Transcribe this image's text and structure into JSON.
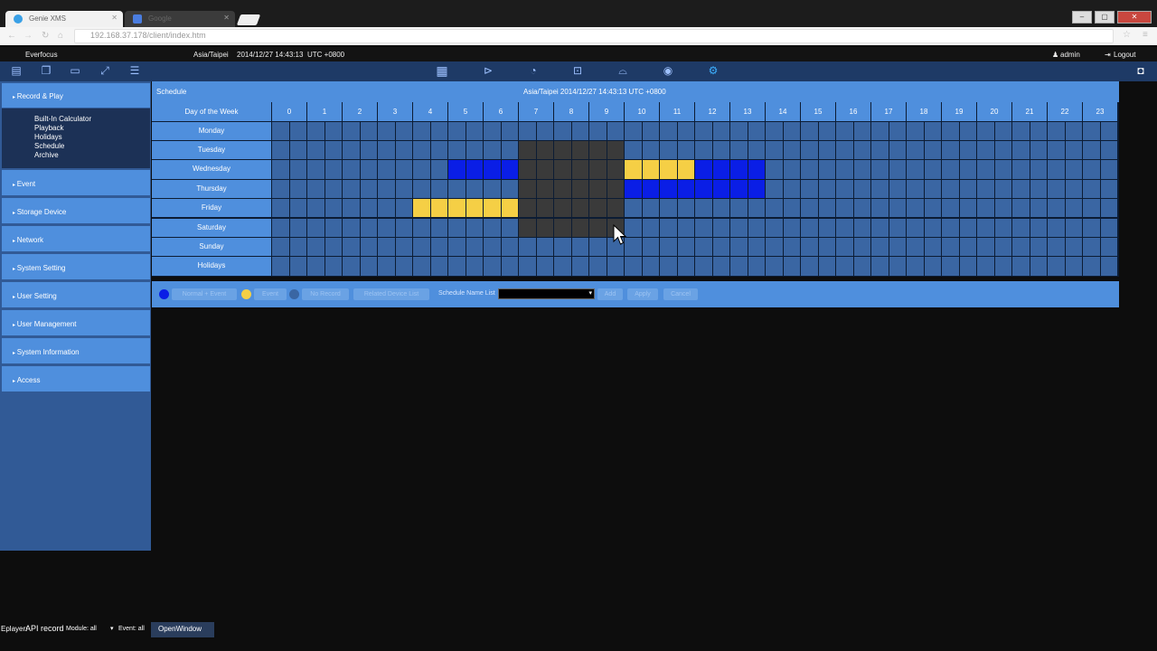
{
  "browser": {
    "tabs": [
      {
        "label": "Genie XMS"
      },
      {
        "label": "Google"
      }
    ],
    "url": "192.168.37.178/client/index.htm"
  },
  "topbar": {
    "brand": "Everfocus",
    "timezone": "Asia/Taipei",
    "datetime": "2014/12/27 14:43:13",
    "utc": "UTC +0800",
    "user": "admin",
    "logout": "Logout"
  },
  "sidebar": {
    "sections": [
      {
        "label": "Record & Play"
      },
      {
        "label": "Event"
      },
      {
        "label": "Storage Device"
      },
      {
        "label": "Network"
      },
      {
        "label": "System Setting"
      },
      {
        "label": "User Setting"
      },
      {
        "label": "User Management"
      },
      {
        "label": "System Information"
      },
      {
        "label": "Access"
      }
    ],
    "subitems": [
      "Built-In Calculator",
      "Playback",
      "Holidays",
      "Schedule",
      "Archive"
    ]
  },
  "schedule": {
    "title": "Schedule",
    "header_time": "Asia/Taipei 2014/12/27 14:43:13 UTC +0800",
    "day_header": "Day of the Week",
    "hours": [
      "0",
      "1",
      "2",
      "3",
      "4",
      "5",
      "6",
      "7",
      "8",
      "9",
      "10",
      "11",
      "12",
      "13",
      "14",
      "15",
      "16",
      "17",
      "18",
      "19",
      "20",
      "21",
      "22",
      "23"
    ],
    "days": [
      "Monday",
      "Tuesday",
      "Wednesday",
      "Thursday",
      "Friday",
      "Saturday",
      "Sunday",
      "Holidays"
    ],
    "colors": {
      "empty": "#3a66a3",
      "normal_event": "#0a1ee6",
      "event": "#f5cf45",
      "selection": "#3a3a3a"
    },
    "blocks": [
      {
        "day": "Wednesday",
        "start": 5,
        "end": 6,
        "type": "normal_event"
      },
      {
        "day": "Wednesday",
        "start": 10,
        "end": 11,
        "type": "event"
      },
      {
        "day": "Wednesday",
        "start": 12,
        "end": 13,
        "type": "normal_event"
      },
      {
        "day": "Thursday",
        "start": 10,
        "end": 13,
        "type": "normal_event"
      },
      {
        "day": "Friday",
        "start": 4,
        "end": 6,
        "type": "event"
      }
    ],
    "selection": {
      "day_from": "Tuesday",
      "day_to": "Saturday",
      "start": 7,
      "end": 9
    }
  },
  "toolbar": {
    "normal_event": "Normal + Event",
    "event": "Event",
    "no_record": "No Record",
    "related_device_list": "Related Device List",
    "schedule_name_list": "Schedule Name List",
    "add": "Add",
    "apply": "Apply",
    "cancel": "Cancel"
  },
  "bottom": {
    "eplayer": "Eplayer:",
    "api_record": "API record",
    "module": "Module: all",
    "event": "Event: all",
    "open_window": "OpenWindow"
  }
}
